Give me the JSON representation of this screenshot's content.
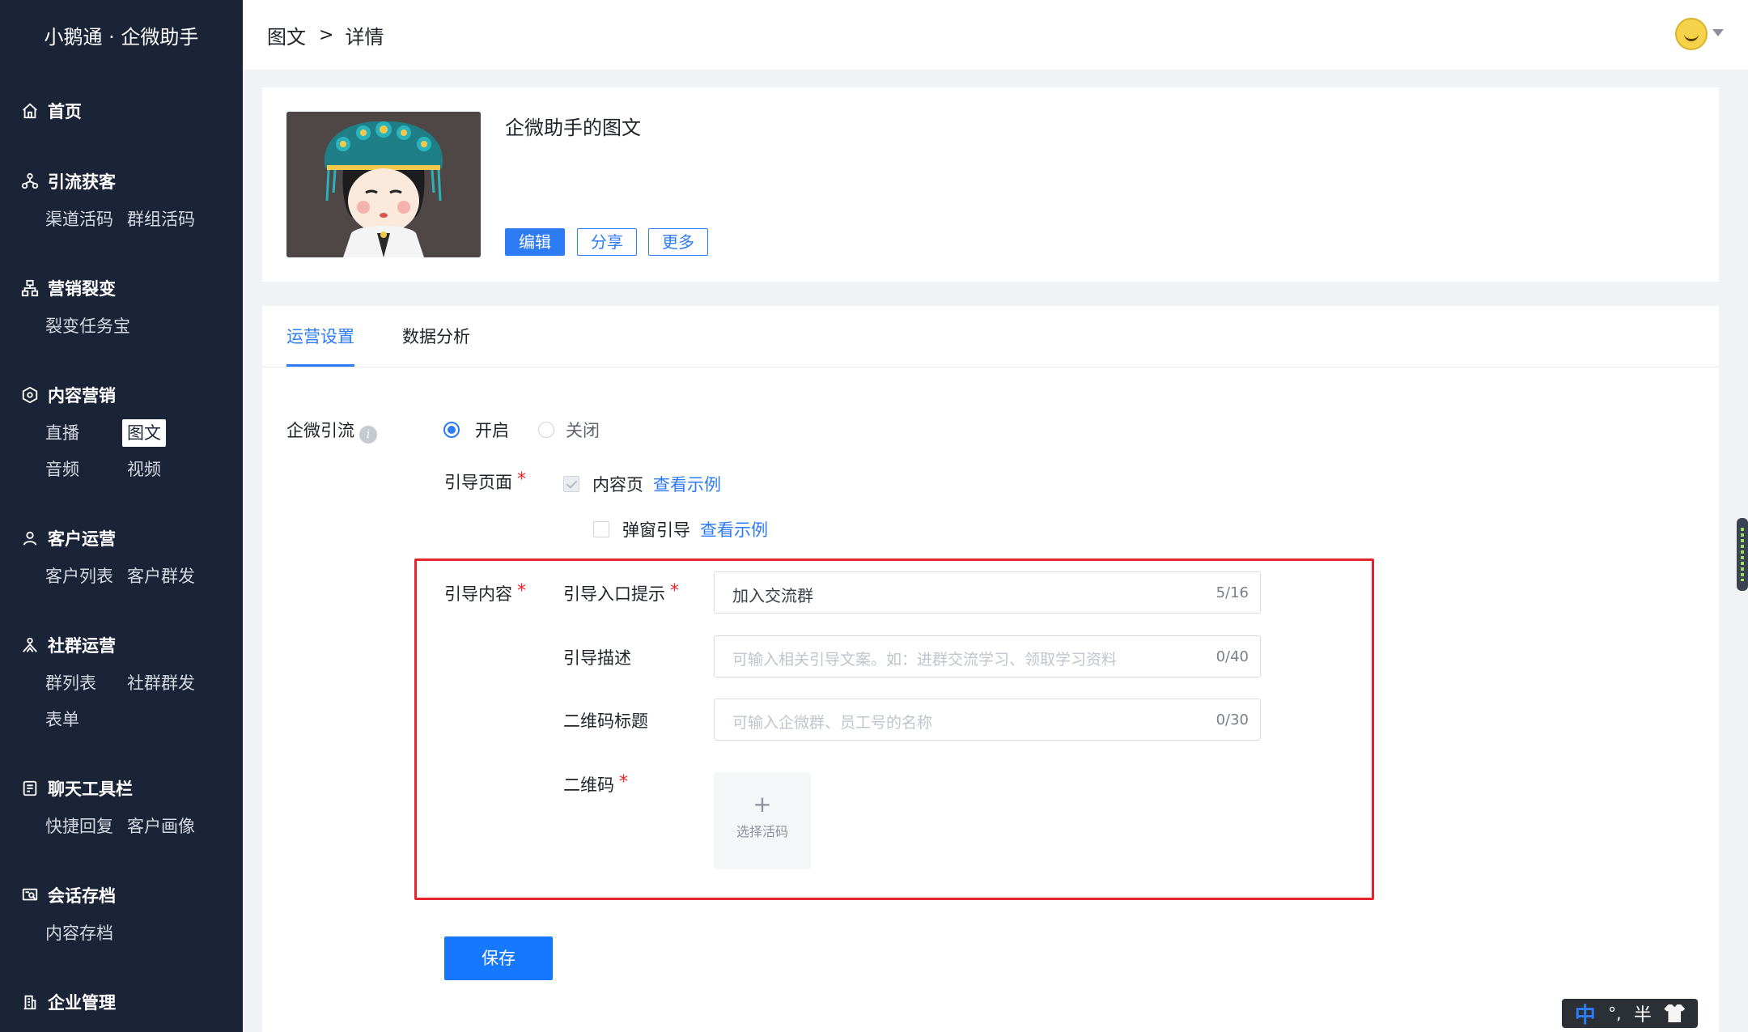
{
  "app": {
    "brand": "小鹅通 · 企微助手"
  },
  "breadcrumb": {
    "parent": "图文",
    "separator": ">",
    "current": "详情"
  },
  "sidebar": {
    "sections": [
      {
        "id": "home",
        "icon": "home-icon",
        "label": "首页",
        "items": []
      },
      {
        "id": "traffic",
        "icon": "network-icon",
        "label": "引流获客",
        "items": [
          "渠道活码",
          "群组活码"
        ]
      },
      {
        "id": "marketing",
        "icon": "sitemap-icon",
        "label": "营销裂变",
        "items": [
          "裂变任务宝"
        ]
      },
      {
        "id": "content",
        "icon": "content-icon",
        "label": "内容营销",
        "items": [
          "直播",
          "图文",
          "音频",
          "视频"
        ],
        "active_item": "图文"
      },
      {
        "id": "customer",
        "icon": "user-icon",
        "label": "客户运营",
        "items": [
          "客户列表",
          "客户群发"
        ]
      },
      {
        "id": "community",
        "icon": "group-icon",
        "label": "社群运营",
        "items": [
          "群列表",
          "社群群发",
          "表单"
        ]
      },
      {
        "id": "chatbar",
        "icon": "toolbar-icon",
        "label": "聊天工具栏",
        "items": [
          "快捷回复",
          "客户画像"
        ]
      },
      {
        "id": "archive",
        "icon": "archive-icon",
        "label": "会话存档",
        "items": [
          "内容存档"
        ]
      },
      {
        "id": "enterprise",
        "icon": "building-icon",
        "label": "企业管理",
        "items": []
      }
    ]
  },
  "article": {
    "title": "企微助手的图文",
    "actions": {
      "edit": "编辑",
      "share": "分享",
      "more": "更多"
    }
  },
  "tabs": {
    "ops": "运营设置",
    "analytics": "数据分析",
    "active": "运营设置"
  },
  "form": {
    "wechat_traffic": {
      "label": "企微引流",
      "info": "i",
      "on_label": "开启",
      "off_label": "关闭",
      "selected": "开启"
    },
    "guide_page": {
      "label": "引导页面",
      "required_mark": "*",
      "options": [
        {
          "label": "内容页",
          "checked": true,
          "disabled": true,
          "example": "查看示例"
        },
        {
          "label": "弹窗引导",
          "checked": false,
          "disabled": false,
          "example": "查看示例"
        }
      ]
    },
    "guide_content": {
      "label": "引导内容",
      "required_mark": "*",
      "entry_tip": {
        "label": "引导入口提示",
        "value": "加入交流群",
        "count": "5/16"
      },
      "description": {
        "label": "引导描述",
        "placeholder": "可输入相关引导文案。如：进群交流学习、领取学习资料",
        "count": "0/40"
      },
      "qr_title": {
        "label": "二维码标题",
        "placeholder": "可输入企微群、员工号的名称",
        "count": "0/30"
      },
      "qr_code": {
        "label": "二维码",
        "plus": "+",
        "upload_text": "选择活码"
      }
    },
    "save_label": "保存"
  },
  "ime": {
    "lang": "中",
    "punct": "°,",
    "width": "半"
  },
  "colors": {
    "sidebar_bg": "#1b2336",
    "accent": "#2d7cf6",
    "highlight_box": "#e5242b",
    "required": "#f5222d"
  }
}
